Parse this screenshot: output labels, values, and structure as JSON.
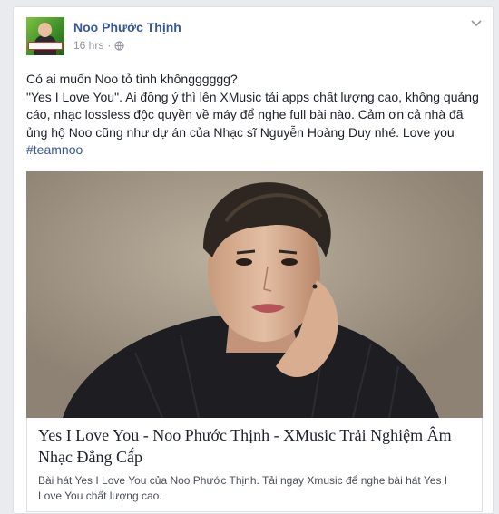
{
  "post": {
    "author": "Noo Phước Thịnh",
    "time": "16 hrs",
    "separator": "·",
    "privacy_icon": "globe-icon",
    "line1": "Có ai muốn Noo tỏ tình khôngggggg?",
    "line2": "\"Yes I Love You\". Ai đồng ý thì lên XMusic tải apps chất lượng cao, không quảng cáo, nhạc lossless độc quyền về máy để nghe full bài nào. Cảm ơn cả nhà đã ủng hộ Noo cũng như dự án của Nhạc sĩ Nguyễn Hoàng Duy nhé. Love you ",
    "hashtag": "#teamnoo"
  },
  "link": {
    "title": "Yes I Love You - Noo Phước Thịnh - XMusic Trải Nghiệm Âm Nhạc Đẳng Cấ́p",
    "description": "Bài hát Yes I Love You của Noo Phước Thịnh. Tải ngay Xmusic để nghe bài hát Yes I Love You chất lượng cao."
  },
  "colors": {
    "link_blue": "#365899",
    "meta_gray": "#90949c",
    "page_bg": "#e9ebee"
  }
}
